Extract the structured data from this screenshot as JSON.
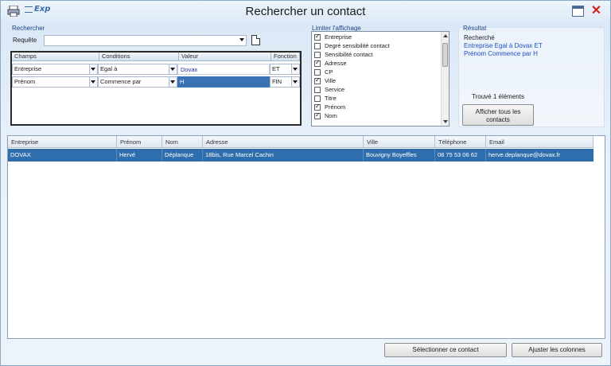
{
  "window": {
    "title": "Rechercher un contact",
    "logo_text": "Exp"
  },
  "search": {
    "group_label": "Rechercher",
    "query_label": "Requête",
    "query_value": "",
    "criteria_headers": [
      "Champs",
      "Conditions",
      "Valeur",
      "Fonction"
    ],
    "rows": [
      {
        "field": "Entreprise",
        "condition": "Egal à",
        "value": "Dovax",
        "function": "ET"
      },
      {
        "field": "Prénom",
        "condition": "Commence par",
        "value": "H",
        "function": "FIN"
      }
    ]
  },
  "limit": {
    "group_label": "Limiter l'affichage",
    "items": [
      {
        "label": "Entreprise",
        "checked": true
      },
      {
        "label": "Degré sensibilité contact",
        "checked": false
      },
      {
        "label": "Sensibilité contact",
        "checked": false
      },
      {
        "label": "Adresse",
        "checked": true
      },
      {
        "label": "CP",
        "checked": false
      },
      {
        "label": "Ville",
        "checked": true
      },
      {
        "label": "Service",
        "checked": false
      },
      {
        "label": "Titre",
        "checked": false
      },
      {
        "label": "Prénom",
        "checked": true
      },
      {
        "label": "Nom",
        "checked": true
      }
    ]
  },
  "result": {
    "group_label": "Résultat",
    "searched_label": "Recherché",
    "criteria_line1": "Entreprise Egal à Dovax ET",
    "criteria_line2": "Prénom Commence par H",
    "found_text": "Trouvé 1 éléments",
    "show_all_label_line1": "Afficher tous les",
    "show_all_label_line2": "contacts"
  },
  "grid": {
    "columns": [
      "Entreprise",
      "Prénom",
      "Nom",
      "Adresse",
      "Ville",
      "Téléphone",
      "Email"
    ],
    "rows": [
      [
        "DOVAX",
        "Hervé",
        "Déplanque",
        "18bis, Rue Marcel Cachin",
        "Bouvigny Boyeffles",
        "08 75 53 06 62",
        "herve.deplanque@dovax.fr"
      ]
    ]
  },
  "footer": {
    "select_label": "Sélectionner ce contact",
    "adjust_label": "Ajuster les colonnes"
  },
  "colors": {
    "selection": "#2f6ead",
    "group_label": "#1d3f8a",
    "close": "#d02020"
  }
}
